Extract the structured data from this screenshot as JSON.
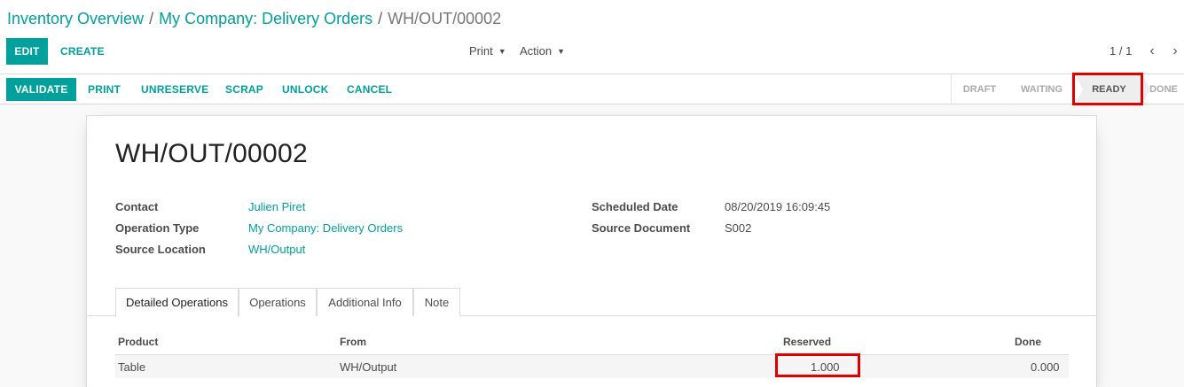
{
  "breadcrumb": {
    "items": [
      "Inventory Overview",
      "My Company: Delivery Orders"
    ],
    "separator": "/",
    "current": "WH/OUT/00002"
  },
  "control_panel": {
    "edit_label": "EDIT",
    "create_label": "CREATE",
    "print_label": "Print",
    "action_label": "Action",
    "pager": "1 / 1"
  },
  "statusbar": {
    "buttons": [
      "VALIDATE",
      "PRINT",
      "UNRESERVE",
      "SCRAP",
      "UNLOCK",
      "CANCEL"
    ],
    "states": [
      "DRAFT",
      "WAITING",
      "READY",
      "DONE"
    ],
    "active_state": "READY"
  },
  "record": {
    "title": "WH/OUT/00002",
    "left_fields": [
      {
        "label": "Contact",
        "value": "Julien Piret"
      },
      {
        "label": "Operation Type",
        "value": "My Company: Delivery Orders"
      },
      {
        "label": "Source Location",
        "value": "WH/Output"
      }
    ],
    "right_fields": [
      {
        "label": "Scheduled Date",
        "value": "08/20/2019 16:09:45"
      },
      {
        "label": "Source Document",
        "value": "S002"
      }
    ]
  },
  "tabs": [
    "Detailed Operations",
    "Operations",
    "Additional Info",
    "Note"
  ],
  "active_tab": "Detailed Operations",
  "table": {
    "columns": [
      "Product",
      "From",
      "Reserved",
      "Done"
    ],
    "rows": [
      {
        "product": "Table",
        "from": "WH/Output",
        "reserved": "1.000",
        "done": "0.000"
      }
    ]
  },
  "colors": {
    "accent": "#00a09d",
    "highlight": "#e00000"
  }
}
